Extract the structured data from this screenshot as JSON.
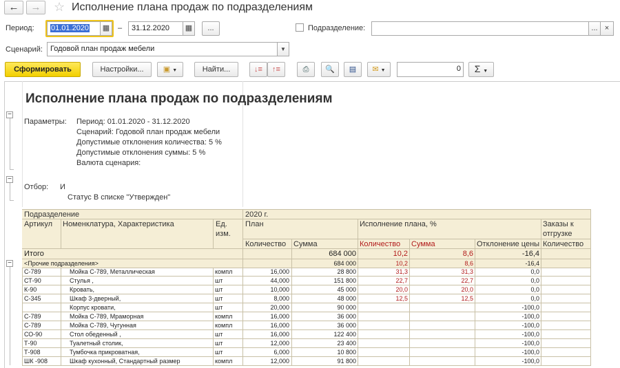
{
  "window": {
    "title": "Исполнение плана продаж по подразделениям"
  },
  "filters": {
    "period_label": "Период:",
    "date_from": "01.01.2020",
    "date_sep": "–",
    "date_to": "31.12.2020",
    "more_label": "...",
    "dept_label": "Подразделение:",
    "dept_value": "",
    "dept_more": "...",
    "dept_clear": "×",
    "scenario_label": "Сценарий:",
    "scenario_value": "Годовой план продаж мебели"
  },
  "toolbar": {
    "form_label": "Сформировать",
    "settings_label": "Настройки...",
    "find_label": "Найти...",
    "number_value": "0",
    "sum_label": "Σ"
  },
  "report": {
    "title": "Исполнение плана продаж по подразделениям",
    "params_label": "Параметры:",
    "params": [
      "Период: 01.01.2020 - 31.12.2020",
      "Сценарий: Годовой план продаж мебели",
      "Допустимые отклонения количества: 5 %",
      "Допустимые отклонения суммы: 5 %",
      "Валюта сценария:"
    ],
    "filter_label": "Отбор:",
    "filter_op": "И",
    "filter_status": "Статус В списке \"Утвержден\""
  },
  "table": {
    "h_dept": "Подразделение",
    "h_year": "2020 г.",
    "h_article": "Артикул",
    "h_nomen": "Номенклатура, Характеристика",
    "h_unit1": "Ед.",
    "h_unit2": "изм.",
    "h_plan": "План",
    "h_exec": "Исполнение плана, %",
    "h_orders1": "Заказы к",
    "h_orders2": "отгрузке",
    "h_qty": "Количество",
    "h_sum": "Сумма",
    "h_eqty": "Количество",
    "h_esum": "Сумма",
    "h_price_dev": "Отклонение цены",
    "h_oqty": "Количество",
    "total": {
      "label": "Итого",
      "qty": "",
      "sum": "684 000",
      "eqty": "10,2",
      "esum": "8,6",
      "dev": "-16,4",
      "oqty": ""
    },
    "group": {
      "label": "<Прочие подразделения>",
      "qty": "",
      "sum": "684 000",
      "eqty": "10,2",
      "esum": "8,6",
      "dev": "-16,4",
      "oqty": ""
    },
    "rows": [
      {
        "art": "С-789",
        "name": "Мойка С-789, Металлическая",
        "unit": "компл",
        "qty": "16,000",
        "sum": "28 800",
        "eqty": "31,3",
        "esum": "31,3",
        "dev": "0,0",
        "oqty": ""
      },
      {
        "art": "СТ-90",
        "name": "Стулья ,",
        "unit": "шт",
        "qty": "44,000",
        "sum": "151 800",
        "eqty": "22,7",
        "esum": "22,7",
        "dev": "0,0",
        "oqty": ""
      },
      {
        "art": "К-90",
        "name": "Кровать,",
        "unit": "шт",
        "qty": "10,000",
        "sum": "45 000",
        "eqty": "20,0",
        "esum": "20,0",
        "dev": "0,0",
        "oqty": ""
      },
      {
        "art": "С-345",
        "name": "Шкаф 3-дверный,",
        "unit": "шт",
        "qty": "8,000",
        "sum": "48 000",
        "eqty": "12,5",
        "esum": "12,5",
        "dev": "0,0",
        "oqty": ""
      },
      {
        "art": "",
        "name": "Корпус кровати,",
        "unit": "шт",
        "qty": "20,000",
        "sum": "90 000",
        "eqty": "",
        "esum": "",
        "dev": "-100,0",
        "oqty": ""
      },
      {
        "art": "С-789",
        "name": "Мойка С-789, Мраморная",
        "unit": "компл",
        "qty": "16,000",
        "sum": "36 000",
        "eqty": "",
        "esum": "",
        "dev": "-100,0",
        "oqty": ""
      },
      {
        "art": "С-789",
        "name": "Мойка С-789, Чугунная",
        "unit": "компл",
        "qty": "16,000",
        "sum": "36 000",
        "eqty": "",
        "esum": "",
        "dev": "-100,0",
        "oqty": ""
      },
      {
        "art": "СО-90",
        "name": "Стол обеденный ,",
        "unit": "шт",
        "qty": "16,000",
        "sum": "122 400",
        "eqty": "",
        "esum": "",
        "dev": "-100,0",
        "oqty": ""
      },
      {
        "art": "Т-90",
        "name": "Туалетный столик,",
        "unit": "шт",
        "qty": "12,000",
        "sum": "23 400",
        "eqty": "",
        "esum": "",
        "dev": "-100,0",
        "oqty": ""
      },
      {
        "art": "Т-908",
        "name": "Тумбочка прикроватная,",
        "unit": "шт",
        "qty": "6,000",
        "sum": "10 800",
        "eqty": "",
        "esum": "",
        "dev": "-100,0",
        "oqty": ""
      },
      {
        "art": "ШК -908",
        "name": "Шкаф кухонный, Стандартный размер",
        "unit": "компл",
        "qty": "12,000",
        "sum": "91 800",
        "eqty": "",
        "esum": "",
        "dev": "-100,0",
        "oqty": ""
      }
    ]
  }
}
